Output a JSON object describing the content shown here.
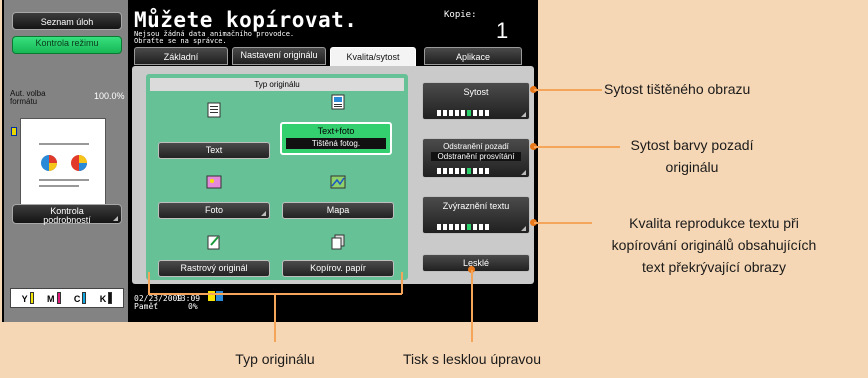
{
  "sidebar": {
    "job_list_label": "Seznam úloh",
    "check_mode_label": "Kontrola režimu",
    "auto_size_label_1": "Aut. volba",
    "auto_size_label_2": "formátu",
    "auto_size_value": "100.0%",
    "check_details_label_1": "Kontrola",
    "check_details_label_2": "podrobností",
    "toners": [
      "Y",
      "M",
      "C",
      "K"
    ]
  },
  "header": {
    "title": "Můžete kopírovat.",
    "subtitle_1": "Nejsou žádná data animačního provodce.",
    "subtitle_2": "Obraťte se na správce.",
    "copies_label": "Kopie:",
    "copies_value": "1"
  },
  "tabs": [
    {
      "label": "Základní"
    },
    {
      "label": "Nastavení originálu"
    },
    {
      "label": "Kvalita/sytost"
    },
    {
      "label": "Aplikace"
    }
  ],
  "original_type": {
    "header": "Typ originálu",
    "buttons": {
      "text": "Text",
      "text_photo": "Text+foto",
      "text_photo_sub": "Tištěná fotog.",
      "photo": "Foto",
      "map": "Mapa",
      "halftone": "Rastrový originál",
      "copied_paper": "Kopírov. papír"
    }
  },
  "right_panel": {
    "density_label": "Sytost",
    "bg_removal_label": "Odstranění pozadí",
    "bg_removal_sub": "Odstranění prosvítání",
    "text_enhance_label": "Zvýraznění textu",
    "glossy_label": "Lesklé",
    "density_level": 6,
    "bg_removal_level": 6,
    "text_enhance_level": 6
  },
  "status": {
    "date": "02/23/2009",
    "time": "13:09",
    "memory_label": "Paměť",
    "memory_value": "0%"
  },
  "callouts": {
    "density": "Sytost tištěného obrazu",
    "bg_density_1": "Sytost barvy pozadí",
    "bg_density_2": "originálu",
    "text_quality_1": "Kvalita reprodukce textu při",
    "text_quality_2": "kopírování originálů obsahujících",
    "text_quality_3": "text překrývající obrazy",
    "original_type": "Typ originálu",
    "glossy_print": "Tisk s lesklou úpravou"
  },
  "colors": {
    "background": "#f6d7b5",
    "accent_green": "#34d06f",
    "panel_green": "#67c196",
    "callout_orange": "#f5a55a"
  }
}
